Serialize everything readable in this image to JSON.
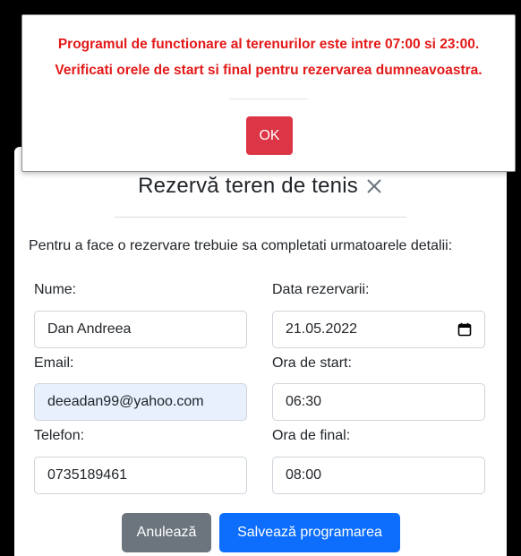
{
  "alert": {
    "line1": "Programul de functionare al terenurilor este intre 07:00 si 23:00.",
    "line2": "Verificati orele de start si final pentru rezervarea dumneavoastra.",
    "ok_label": "OK",
    "text_color": "#e31919",
    "ok_color": "#dc3545"
  },
  "modal": {
    "title": "Rezervă teren de tenis",
    "close_icon": "close-icon",
    "instructions": "Pentru a face o rezervare trebuie sa completati urmatoarele detalii:",
    "fields": {
      "name": {
        "label": "Nume:",
        "value": "Dan Andreea"
      },
      "date": {
        "label": "Data rezervarii:",
        "value": "21.05.2022",
        "icon": "calendar-icon"
      },
      "email": {
        "label": "Email:",
        "value": "deeadan99@yahoo.com"
      },
      "start": {
        "label": "Ora de start:",
        "value": "06:30"
      },
      "phone": {
        "label": "Telefon:",
        "value": "0735189461"
      },
      "end": {
        "label": "Ora de final:",
        "value": "08:00"
      }
    },
    "buttons": {
      "cancel_label": "Anulează",
      "save_label": "Salvează programarea",
      "cancel_color": "#6c757d",
      "save_color": "#0d6efd"
    }
  }
}
